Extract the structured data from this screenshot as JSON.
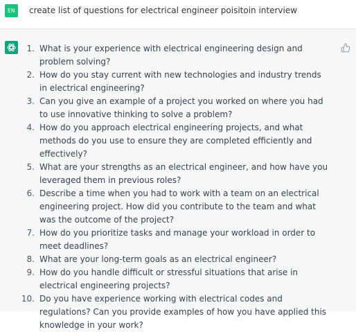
{
  "user": {
    "avatar": "EN",
    "message": "create list of questions for electrical engineer poisitoin interview"
  },
  "assistant": {
    "avatar_icon": "chatgpt-logo-icon",
    "items": [
      {
        "num": "1.",
        "text": "What is your experience with electrical engineering design and problem solving?"
      },
      {
        "num": "2.",
        "text": "How do you stay current with new technologies and industry trends in electrical engineering?"
      },
      {
        "num": "3.",
        "text": "Can you give an example of a project you worked on where you had to use innovative thinking to solve a problem?"
      },
      {
        "num": "4.",
        "text": "How do you approach electrical engineering projects, and what methods do you use to ensure they are completed efficiently and effectively?"
      },
      {
        "num": "5.",
        "text": "What are your strengths as an electrical engineer, and how have you leveraged them in previous roles?"
      },
      {
        "num": "6.",
        "text": "Describe a time when you had to work with a team on an electrical engineering project. How did you contribute to the team and what was the outcome of the project?"
      },
      {
        "num": "7.",
        "text": "How do you prioritize tasks and manage your workload in order to meet deadlines?"
      },
      {
        "num": "8.",
        "text": "What are your long-term goals as an electrical engineer?"
      },
      {
        "num": "9.",
        "text": "How do you handle difficult or stressful situations that arise in electrical engineering projects?"
      },
      {
        "num": "10.",
        "text": "Do you have experience working with electrical codes and regulations? Can you provide examples of how you have applied this knowledge in your work?"
      }
    ],
    "feedback_icon": "thumbs-up-icon"
  },
  "colors": {
    "user_avatar": "#19c37d",
    "bot_avatar": "#10a37f",
    "bot_background": "#f7f7f8",
    "text": "#374151"
  }
}
